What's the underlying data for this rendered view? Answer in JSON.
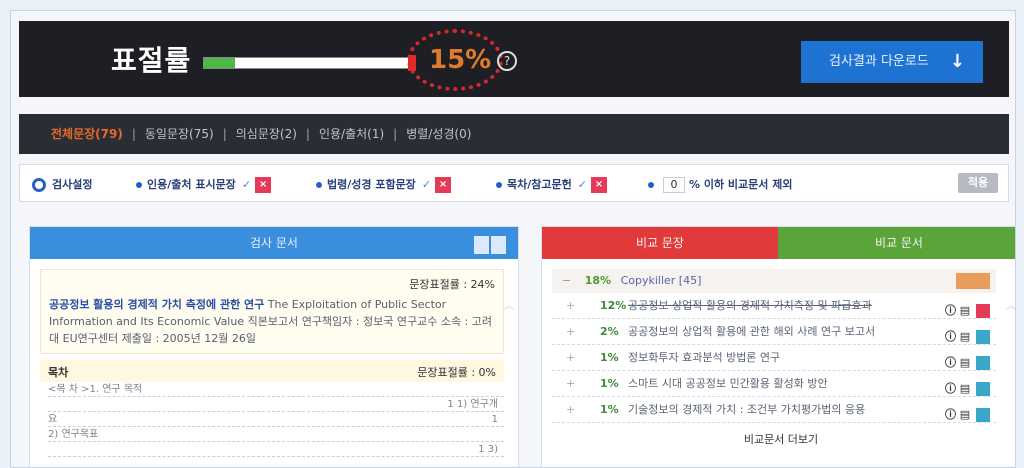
{
  "topbar": {
    "rate_title": "표절률",
    "rate_value": "15%",
    "rate_fraction": 0.15,
    "help_icon": "?",
    "download_label": "검사결과 다운로드",
    "download_icon": "arrow-down-icon"
  },
  "tabs": [
    {
      "label": "전체문장(79)",
      "active": true
    },
    {
      "label": "동일문장(75)",
      "active": false
    },
    {
      "label": "의심문장(2)",
      "active": false
    },
    {
      "label": "인용/출처(1)",
      "active": false
    },
    {
      "label": "병렬/성경(0)",
      "active": false
    }
  ],
  "options": {
    "settings_label": "검사설정",
    "opt1": "인용/출처 표시문장",
    "opt2": "법령/성경 포함문장",
    "opt3": "목차/참고문헌",
    "opt4_prefix": "",
    "opt4_value": "0",
    "opt4_suffix": "% 이하 비교문서 제외",
    "check": "✓",
    "x": "×",
    "confirm_label": "적용"
  },
  "left": {
    "header": "검사 문서",
    "rate_line": "문장표절률 : 24%",
    "doc_title_bold": "공공정보 활용의 경제적 가치 측정에 관한 연구",
    "doc_title_rest": " The Exploitation of Public Sector Information and Its Economic Value 직본보고서 연구책임자 : 정보국 연구교수 소속 : 고려대 EU연구센터 제출일 : 2005년 12월 26일",
    "toc_label": "목차",
    "toc_rate": "문장표절률 : 0%",
    "toc_lines": [
      {
        "l": "<목 차 >1. 연구 목적",
        "r": ""
      },
      {
        "l": "",
        "r": "1 1) 연구개"
      },
      {
        "l": "요",
        "r": "1"
      },
      {
        "l": "2) 연구목표",
        "r": ""
      },
      {
        "l": "",
        "r": "1 3)"
      }
    ]
  },
  "right": {
    "tab_sentence": "비교 문장",
    "tab_document": "비교 문서",
    "group_pct": "18%",
    "group_name": "Copykiller [45]",
    "rows": [
      {
        "pct": "12%",
        "title": "공공정보 상업적 활용의 경제적 가치측정 및 파급효과"
      },
      {
        "pct": "2%",
        "title": "공공정보의 상업적 활용에 관한 해외 사례 연구 보고서"
      },
      {
        "pct": "1%",
        "title": "정보화투자 효과분석 방법론 연구"
      },
      {
        "pct": "1%",
        "title": "스마트 시대 공공정보 민간활용 활성화 방안"
      },
      {
        "pct": "1%",
        "title": "기술정보의 경제적 가치 : 조건부 가치평가법의 응용"
      }
    ],
    "more_label": "비교문서 더보기"
  }
}
